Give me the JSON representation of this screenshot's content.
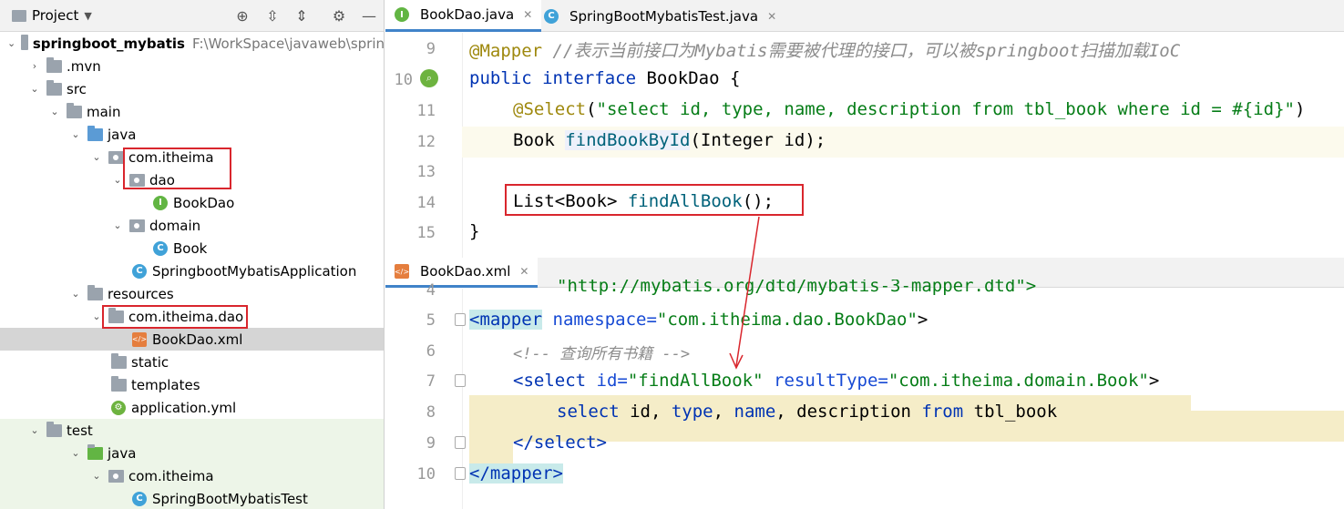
{
  "project": {
    "title": "Project",
    "tree": [
      {
        "label": "springboot_mybatis",
        "extra": "F:\\WorkSpace\\javaweb\\sprin",
        "icon": "module-folder-icon"
      },
      {
        "label": ".mvn",
        "icon": "folder-icon"
      },
      {
        "label": "src",
        "icon": "folder-icon"
      },
      {
        "label": "main",
        "icon": "folder-icon"
      },
      {
        "label": "java",
        "icon": "source-folder-icon"
      },
      {
        "label": "com.itheima",
        "icon": "package-icon"
      },
      {
        "label": "dao",
        "icon": "package-icon"
      },
      {
        "label": "BookDao",
        "icon": "interface-icon"
      },
      {
        "label": "domain",
        "icon": "package-icon"
      },
      {
        "label": "Book",
        "icon": "class-icon"
      },
      {
        "label": "SpringbootMybatisApplication",
        "icon": "spring-boot-class-icon"
      },
      {
        "label": "resources",
        "icon": "resources-folder-icon"
      },
      {
        "label": "com.itheima.dao",
        "icon": "folder-icon"
      },
      {
        "label": "BookDao.xml",
        "icon": "xml-file-icon"
      },
      {
        "label": "static",
        "icon": "folder-icon"
      },
      {
        "label": "templates",
        "icon": "folder-icon"
      },
      {
        "label": "application.yml",
        "icon": "yaml-file-icon"
      },
      {
        "label": "test",
        "icon": "folder-icon"
      },
      {
        "label": "java",
        "icon": "test-source-folder-icon"
      },
      {
        "label": "com.itheima",
        "icon": "package-icon"
      },
      {
        "label": "SpringBootMybatisTest",
        "icon": "spring-boot-class-icon"
      }
    ]
  },
  "top_tabs": [
    {
      "label": "BookDao.java",
      "icon": "interface-icon"
    },
    {
      "label": "SpringBootMybatisTest.java",
      "icon": "class-icon"
    }
  ],
  "top_editor": {
    "line_numbers": [
      "9",
      "10",
      "11",
      "12",
      "13",
      "14",
      "15"
    ],
    "l9_ann": "@Mapper",
    "l9_cmt": " //表示当前接口为Mybatis需要被代理的接口，可以被springboot扫描加载IoC",
    "l10_kw": "public interface",
    "l10_rest": " BookDao {",
    "l11_ann": "@Select",
    "l11_open": "(",
    "l11_str": "\"select id, type, name, description from tbl_book where id = #{id}\"",
    "l11_close": ")",
    "l12_type": "Book ",
    "l12_fn": "findBookById",
    "l12_rest": "(Integer id);",
    "l14_type": "List<Book> ",
    "l14_fn": "findAllBook",
    "l14_rest": "();",
    "l15": "}"
  },
  "bottom_tabs": [
    {
      "label": "BookDao.xml",
      "icon": "xml-file-icon"
    }
  ],
  "bottom_editor": {
    "line_numbers": [
      "4",
      "5",
      "6",
      "7",
      "8",
      "9",
      "10"
    ],
    "l4": "\"http://mybatis.org/dtd/mybatis-3-mapper.dtd\">",
    "l5_open": "<mapper",
    "l5_attr": " namespace=",
    "l5_val": "\"com.itheima.dao.BookDao\"",
    "l5_close": ">",
    "l6": "<!-- 查询所有书籍 -->",
    "l7_open": "<select",
    "l7_attr1": " id=",
    "l7_val1": "\"findAllBook\"",
    "l7_attr2": " resultType=",
    "l7_val2": "\"com.itheima.domain.Book\"",
    "l7_close": ">",
    "l8_kw1": "select",
    "l8_t1": " id, ",
    "l8_kw2": "type",
    "l8_t2": ", ",
    "l8_kw3": "name",
    "l8_t3": ", description ",
    "l8_kw4": "from",
    "l8_t4": " tbl_book",
    "l9": "</select>",
    "l10": "</mapper>"
  },
  "colors": {
    "annotation": "#d9262d",
    "accent": "#4083c9"
  }
}
